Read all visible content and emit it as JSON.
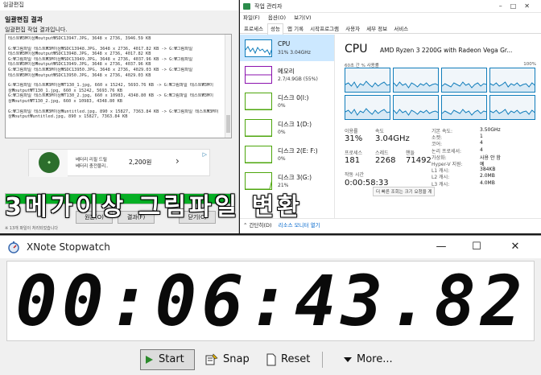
{
  "left_window": {
    "title": "일괄편집",
    "heading": "일괄편집 결과",
    "subtitle": "일괄편집 작업 결과입니다.",
    "log_lines": [
      "테스트₩3M이상₩output₩SDC13947.JPG, 3648 x 2736, 3946.59 KB",
      "",
      "G:₩그림파일 테스트₩3M이상₩SDC13948.JPG, 3648 x 2736, 4017.82 KB -> G:₩그림파일",
      "테스트₩3M이상₩output₩SDC13948.JPG, 3648 x 2736, 4017.82 KB",
      "G:₩그림파일 테스트₩3M이상₩SDC13949.JPG, 3648 x 2736, 4037.96 KB -> G:₩그림파일",
      "테스트₩3M이상₩output₩SDC13949.JPG, 3648 x 2736, 4037.96 KB",
      "G:₩그림파일 테스트₩3M이상₩SDC13950.JPG, 3648 x 2736, 4029.03 KB -> G:₩그림파일",
      "테스트₩3M이상₩output₩SDC13950.JPG, 3648 x 2736, 4029.03 KB",
      "",
      "G:₩그림파일 테스트₩3M이상₩T130_1.jpg, 660 x 15242, 5693.76 KB -> G:₩그림파일 테스트₩3M이",
      "상₩output₩T130_1.jpg, 660 x 15242, 5693.76 KB",
      "G:₩그림파일 테스트₩3M이상₩T130_2.jpg, 660 x 10983, 4348.80 KB -> G:₩그림파일 테스트₩3M이",
      "상₩output₩T130_2.jpg, 660 x 10983, 4348.80 KB",
      "",
      "G:₩그림파일 테스트₩3M이상₩untitled.jpg, 890 x 15827, 7363.84 KB -> G:₩그림파일 테스트₩3M이",
      "상₩output₩untitled.jpg, 890 x 15827, 7363.84 KB"
    ],
    "ad": {
      "text_line1": "베터리 리필 드릴",
      "text_line2": "베터리 충전물리..",
      "price": "2,200원",
      "arrow": "›",
      "mark": "▷"
    },
    "progress_percent": 100,
    "buttons": [
      "원본(O)",
      "결과(F)",
      "닫기(C)"
    ],
    "footer": "※ 13개 파일이 처리되었습니다"
  },
  "task_manager": {
    "title": "작업 관리자",
    "window_controls": [
      "–",
      "□",
      "✕"
    ],
    "menu": [
      "파일(F)",
      "옵션(O)",
      "보기(V)"
    ],
    "tabs": [
      "프로세스",
      "성능",
      "앱 기록",
      "시작프로그램",
      "사용자",
      "세부 정보",
      "서비스"
    ],
    "active_tab": "성능",
    "sidebar": [
      {
        "name": "CPU",
        "value": "31% 3.04GHz",
        "kind": "cpu"
      },
      {
        "name": "메모리",
        "value": "2.7/4.9GB (55%)",
        "kind": "mem"
      },
      {
        "name": "디스크 0(I:)",
        "value": "0%",
        "kind": "disk"
      },
      {
        "name": "디스크 1(D:)",
        "value": "0%",
        "kind": "disk"
      },
      {
        "name": "디스크 2(E: F:)",
        "value": "0%",
        "kind": "disk"
      },
      {
        "name": "디스크 3(G:)",
        "value": "21%",
        "kind": "disk"
      }
    ],
    "cpu_title": "CPU",
    "cpu_model": "AMD Ryzen 3 2200G with Radeon Vega Gr...",
    "graph_label": "60초 간 % 사용률",
    "graph_max": "100%",
    "stats": {
      "usage_label": "이용률",
      "usage_value": "31%",
      "speed_label": "속도",
      "speed_value": "3.04GHz",
      "processes_label": "프로세스",
      "processes_value": "181",
      "threads_label": "스레드",
      "threads_value": "2268",
      "handles_label": "핸들",
      "handles_value": "71492",
      "uptime_label": "작동 시간",
      "uptime_value": "0:00:58:33"
    },
    "specs": [
      {
        "label": "기본 속도:",
        "value": "3.50GHz"
      },
      {
        "label": "소켓:",
        "value": "1"
      },
      {
        "label": "코어:",
        "value": "4"
      },
      {
        "label": "논리 프로세서:",
        "value": "4"
      },
      {
        "label": "가상화:",
        "value": "사용 안 함"
      },
      {
        "label": "Hyper-V 지원:",
        "value": "예"
      },
      {
        "label": "L1 캐시:",
        "value": "384KB"
      },
      {
        "label": "L2 캐시:",
        "value": "2.0MB"
      },
      {
        "label": "L3 캐시:",
        "value": "4.0MB"
      }
    ],
    "bottom_simple": "⌃ 간단히(D)",
    "bottom_link": "리소스 모니터 열기",
    "tooltip": "더 빠른 조회는 크기 요청을 계"
  },
  "caption": "3메가이상 그림파일 변환",
  "stopwatch": {
    "title": "XNote Stopwatch",
    "time": "00:06:43.82",
    "window_controls": [
      "—",
      "☐",
      "✕"
    ],
    "buttons": {
      "start": "Start",
      "snap": "Snap",
      "reset": "Reset",
      "more": "More..."
    }
  }
}
